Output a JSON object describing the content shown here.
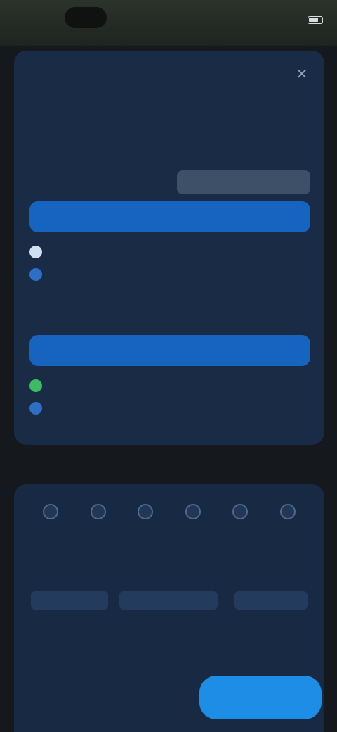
{
  "status_bar": {
    "time": "",
    "indicators": ""
  },
  "sheet": {
    "title": "",
    "tabs": [
      "",
      "",
      "",
      "",
      ""
    ],
    "section1": {
      "label": "",
      "right": ""
    },
    "date_row": {
      "text": "",
      "pill": ""
    },
    "bar1_label": "",
    "legend1": [
      {
        "text": "",
        "color": "#cfe0f2"
      },
      {
        "text": "",
        "color": "#2d6fc4"
      }
    ],
    "section2": {
      "label": "",
      "right": ""
    },
    "bar2_label": "",
    "legend2": [
      {
        "text": "",
        "color": "#3cbb62"
      },
      {
        "text": "",
        "color": "#2d6fc4"
      }
    ]
  },
  "footer_label": "",
  "panel2": {
    "steps": [
      "",
      "",
      "",
      "",
      "",
      ""
    ],
    "row_label": "",
    "row_right": "",
    "chips": [
      "",
      "",
      ""
    ],
    "note": ""
  },
  "bottom": {
    "left_label": "",
    "mid_label": "",
    "left_label2": "",
    "primary_button": ""
  },
  "colors": {
    "accent": "#1e8de6",
    "bar": "#1764c0",
    "panel": "#1a2c45"
  }
}
